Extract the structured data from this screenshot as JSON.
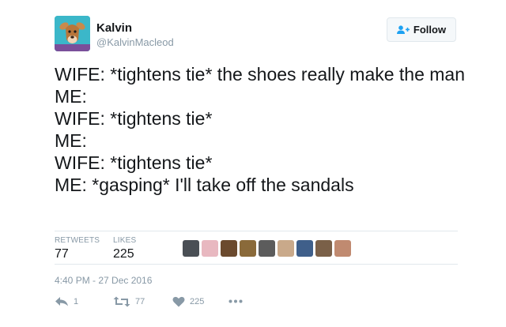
{
  "user": {
    "name": "Kalvin",
    "handle": "@KalvinMacleod",
    "avatar_icon": "deer-cartoon-avatar"
  },
  "follow_button": {
    "label": "Follow",
    "icon": "add-person-icon"
  },
  "tweet": {
    "lines": [
      "WIFE: *tightens tie* the shoes really make the man",
      "ME:",
      "WIFE: *tightens tie*",
      "ME:",
      "WIFE: *tightens tie*",
      "ME: *gasping* I'll take off the sandals"
    ]
  },
  "stats": {
    "retweets_label": "RETWEETS",
    "retweets_value": "77",
    "likes_label": "LIKES",
    "likes_value": "225"
  },
  "liker_avatars": [
    "#4a4f55",
    "#e8b8c0",
    "#6b4a2e",
    "#8a6a3a",
    "#5c5c5c",
    "#c9a98a",
    "#3f5f8a",
    "#7a6048",
    "#c08a70"
  ],
  "timestamp": "4:40 PM - 27 Dec 2016",
  "actions": {
    "reply_count": "1",
    "retweet_count": "77",
    "like_count": "225",
    "more_icon": "more-dots-icon"
  },
  "colors": {
    "text": "#14171a",
    "muted": "#8899a6",
    "accent": "#1da1f2",
    "divider": "#e1e8ed"
  }
}
